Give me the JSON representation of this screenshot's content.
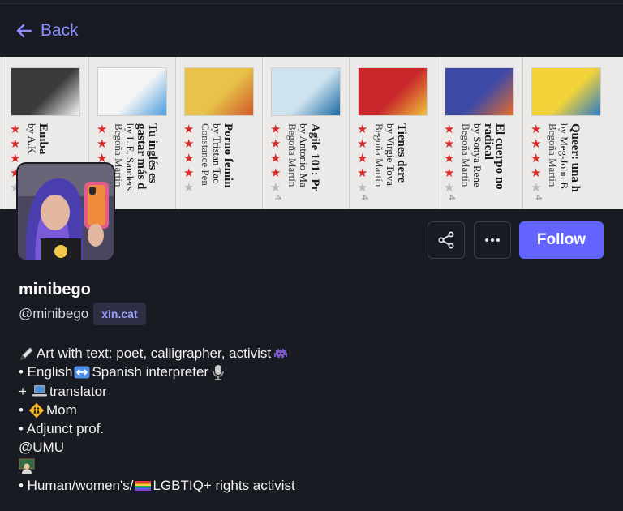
{
  "nav": {
    "back_label": "Back"
  },
  "banner": {
    "books": [
      {
        "title": "Emba",
        "author": "by A.K",
        "author2": "",
        "cover_color": "#3a3a3a",
        "cover_accent": "#f7f7f7",
        "rating_text": ""
      },
      {
        "title": "Tu inglés es",
        "title2": "gastar más d",
        "author": "by L.E. Sanders",
        "author2": "Begoña Martín",
        "cover_color": "#f5f5f5",
        "cover_accent": "#4a9be0",
        "rating_text": ""
      },
      {
        "title": "Porno femin",
        "author": "by Tristan Tao",
        "author2": "Constance Pen",
        "cover_color": "#e8c24a",
        "cover_accent": "#d05a2a",
        "rating_text": ""
      },
      {
        "title": "Agile 101: Pr",
        "author": "by Antonio Ma",
        "author2": "Begoña Martín",
        "cover_color": "#cfe3ef",
        "cover_accent": "#1b6aa5",
        "rating_text": "4"
      },
      {
        "title": "Tienes dere",
        "author": "by Virgie Tova",
        "author2": "Begoña Martín",
        "cover_color": "#c8262a",
        "cover_accent": "#f0c13a",
        "rating_text": "4"
      },
      {
        "title": "El cuerpo no",
        "title2": "radical",
        "author": "by Sonya Rene",
        "author2": "Begoña Martín",
        "cover_color": "#3c4aa6",
        "cover_accent": "#e66c2c",
        "rating_text": "4"
      },
      {
        "title": "Queer: una h",
        "author": "by Meg-John B",
        "author2": "Begoña Martín",
        "cover_color": "#f2d43a",
        "cover_accent": "#2d7ac7",
        "rating_text": "4"
      }
    ]
  },
  "actions": {
    "share_icon": "share-icon",
    "more_icon": "more-horizontal-icon",
    "follow_label": "Follow"
  },
  "profile": {
    "display_name": "minibego",
    "handle": "@minibego",
    "domain": "xin.cat"
  },
  "bio": {
    "line1": "Art with text: poet, calligrapher, activist",
    "line2_a": "• English",
    "line2_b": "Spanish interpreter",
    "line3_a": "+",
    "line3_b": " translator",
    "line4_a": "•",
    "line4_b": " Mom",
    "line5": "• Adjunct prof.",
    "line6": "@UMU",
    "line8_a": "• Human/women's/",
    "line8_b": "LGBTIQ+ rights activist"
  },
  "colors": {
    "accent": "#6364ff",
    "link": "#8c8dff",
    "background": "#191b22",
    "badge_bg": "#2d3044",
    "star": "#d82c2c"
  }
}
